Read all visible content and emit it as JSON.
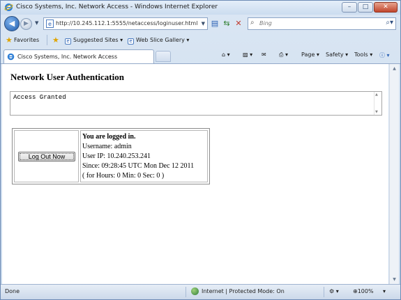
{
  "window": {
    "title": "Cisco Systems, Inc. Network Access - Windows Internet Explorer",
    "minimize_icon": "minimize-icon",
    "maximize_icon": "maximize-icon",
    "close_icon": "close-icon"
  },
  "navigation": {
    "address": "http://10.245.112.1:5555/netaccess/loginuser.html",
    "search_placeholder": "Bing"
  },
  "favorites_bar": {
    "favorites_label": "Favorites",
    "links": [
      "Suggested Sites ▾",
      "Web Slice Gallery ▾"
    ]
  },
  "tab": {
    "title": "Cisco Systems, Inc. Network Access"
  },
  "command_bar": {
    "page": "Page ▾",
    "safety": "Safety ▾",
    "tools": "Tools ▾"
  },
  "page": {
    "heading": "Network User Authentication",
    "message": "Access Granted",
    "logout_button": "Log Out Now",
    "info": {
      "logged_in": "You are logged in.",
      "username": "Username: admin",
      "user_ip": "User IP: 10.240.253.241",
      "since": "Since: 09:28:45 UTC Mon Dec 12 2011",
      "duration": "( for Hours: 0 Min: 0 Sec: 0 )"
    }
  },
  "status_bar": {
    "status": "Done",
    "zone": "Internet | Protected Mode: On",
    "zoom": "⊕100%"
  }
}
